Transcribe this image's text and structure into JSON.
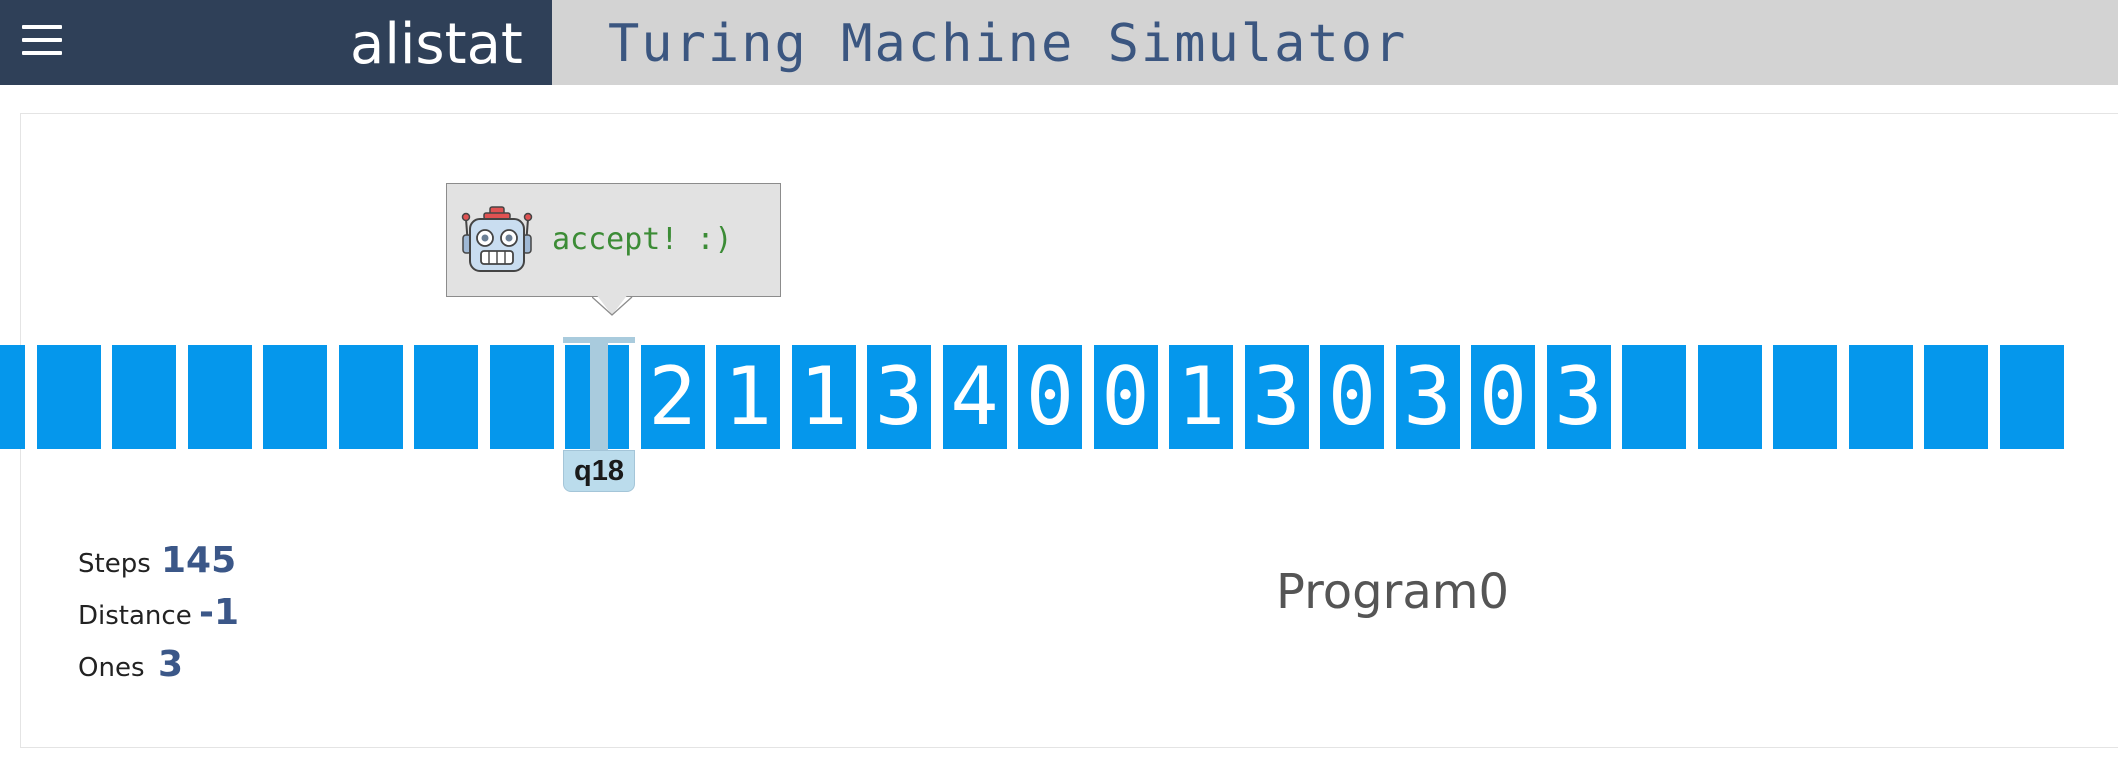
{
  "header": {
    "logo": "alistat",
    "title": "Turing Machine Simulator",
    "menu_icon": "hamburger-menu-icon"
  },
  "message": {
    "text": "accept! :)",
    "icon": "robot-icon"
  },
  "tape": {
    "cells": [
      "",
      "",
      "",
      "",
      "",
      "",
      "",
      "",
      "",
      "2",
      "1",
      "1",
      "3",
      "4",
      "0",
      "0",
      "1",
      "3",
      "0",
      "3",
      "0",
      "3",
      "",
      "",
      "",
      "",
      "",
      ""
    ],
    "head_state": "q18"
  },
  "stats": {
    "steps_label": "Steps",
    "steps": "145",
    "distance_label": "Distance",
    "distance": "-1",
    "ones_label": "Ones",
    "ones": "3"
  },
  "program": {
    "name": "Program0"
  },
  "colors": {
    "header_dark": "#2f4058",
    "header_light": "#d3d3d3",
    "title_text": "#3b5680",
    "tape_cell": "#0597ec",
    "head": "#a9cbdd",
    "accept_text": "#3c8c36",
    "stat_value": "#3b5788"
  }
}
